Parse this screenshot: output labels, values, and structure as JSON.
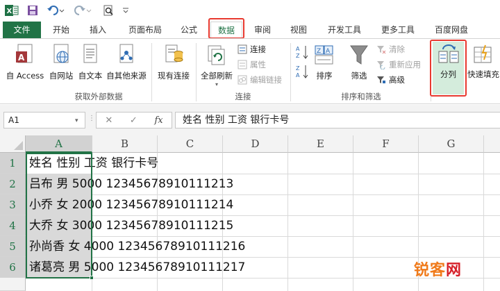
{
  "quick_access": {
    "app_icon": "excel-icon",
    "save": "save-icon",
    "undo": "undo-icon",
    "redo": "redo-icon",
    "preview": "print-preview-icon",
    "customize": "customize-qat-icon"
  },
  "tabs": [
    {
      "label": "文件"
    },
    {
      "label": "开始"
    },
    {
      "label": "插入"
    },
    {
      "label": "页面布局"
    },
    {
      "label": "公式"
    },
    {
      "label": "数据"
    },
    {
      "label": "审阅"
    },
    {
      "label": "视图"
    },
    {
      "label": "开发工具"
    },
    {
      "label": "更多工具"
    },
    {
      "label": "百度网盘"
    }
  ],
  "ribbon": {
    "get_external": {
      "label": "获取外部数据",
      "buttons": [
        "自 Access",
        "自网站",
        "自文本",
        "自其他来源",
        "现有连接"
      ]
    },
    "connections": {
      "label": "连接",
      "refresh_all": "全部刷新",
      "items": [
        "连接",
        "属性",
        "编辑链接"
      ]
    },
    "sort_filter": {
      "label": "排序和筛选",
      "sort": "排序",
      "filter": "筛选",
      "items": [
        "清除",
        "重新应用",
        "高级"
      ]
    },
    "tools": {
      "text_to_columns": "分列",
      "flash_fill": "快速填充"
    }
  },
  "formula_bar": {
    "name_box": "A1",
    "cancel": "✕",
    "enter": "✓",
    "fx": "fx",
    "content": "姓名 性别 工资 银行卡号"
  },
  "sheet": {
    "columns": [
      "A",
      "B",
      "C",
      "D",
      "E",
      "F",
      "G"
    ],
    "rows": [
      "1",
      "2",
      "3",
      "4",
      "5",
      "6"
    ],
    "cells": [
      "姓名 性别 工资 银行卡号",
      "吕布 男 5000 12345678910111213",
      "小乔 女 2000 12345678910111214",
      "大乔 女 3000 12345678910111215",
      "孙尚香 女 4000 12345678910111216",
      "诸葛亮 男 5000 12345678910111217"
    ]
  },
  "watermark": {
    "part1": "锐客",
    "part2": "网"
  },
  "colors": {
    "excel_green": "#217346",
    "highlight_red": "#e8392f",
    "watermark_orange": "#f07a1a",
    "watermark_red": "#d6212a"
  }
}
